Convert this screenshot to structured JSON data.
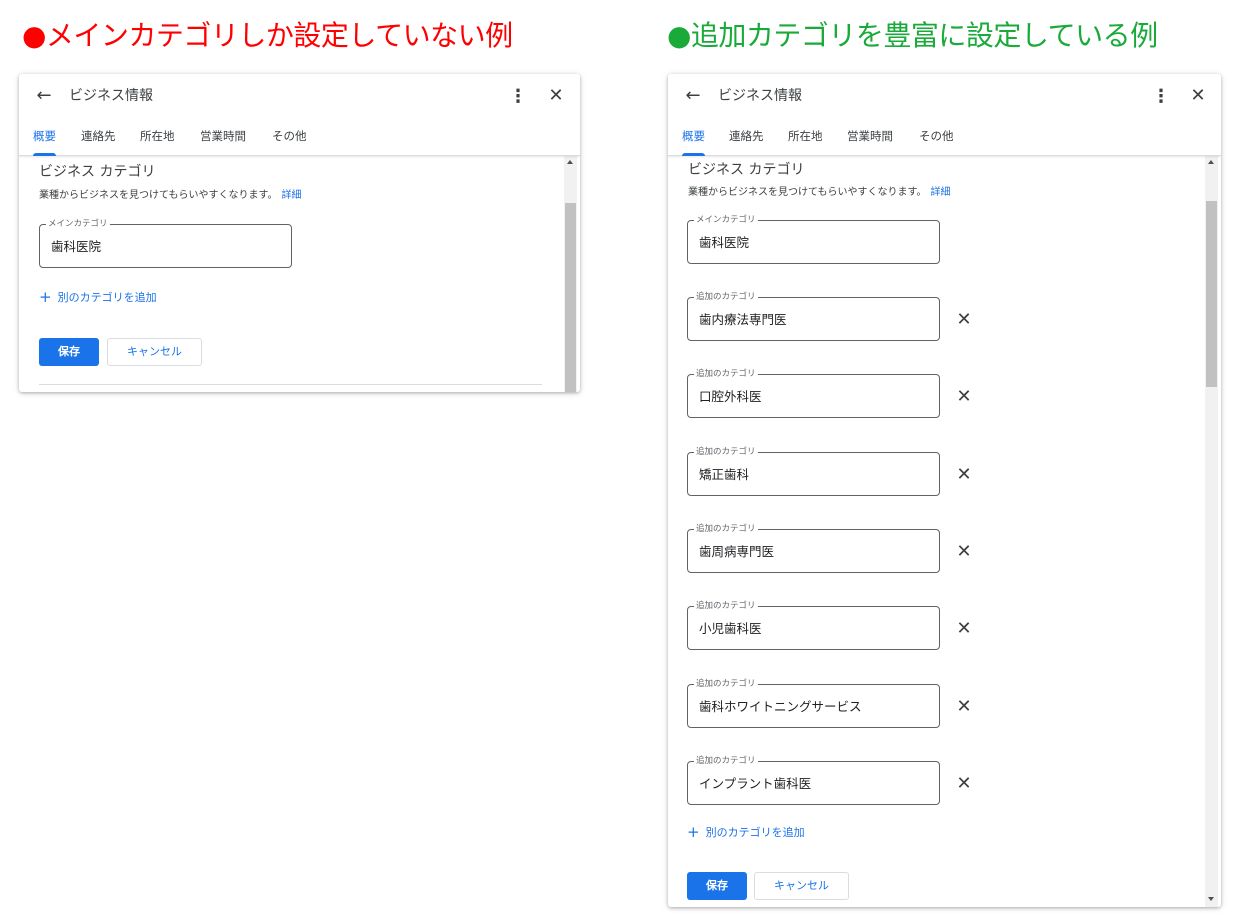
{
  "headings": {
    "left": "●メインカテゴリしか設定していない例",
    "right": "●追加カテゴリを豊富に設定している例"
  },
  "colors": {
    "left_heading": "#ff0000",
    "right_heading": "#1aaa3a",
    "accent": "#1a73e8"
  },
  "dialog": {
    "back_icon": "arrow-left-icon",
    "title": "ビジネス情報",
    "more_icon": "more-vert-icon",
    "close_icon": "close-icon",
    "tabs": [
      "概要",
      "連絡先",
      "所在地",
      "営業時間",
      "その他"
    ],
    "active_tab": "概要",
    "section_title": "ビジネス カテゴリ",
    "section_desc": "業種からビジネスを見つけてもらいやすくなります。",
    "details_link": "詳細",
    "main_category_label": "メインカテゴリ",
    "additional_category_label": "追加のカテゴリ",
    "add_category": "別のカテゴリを追加",
    "save": "保存",
    "cancel": "キャンセル"
  },
  "left_panel": {
    "main_category": "歯科医院"
  },
  "right_panel": {
    "main_category": "歯科医院",
    "additional_categories": [
      "歯内療法専門医",
      "口腔外科医",
      "矯正歯科",
      "歯周病専門医",
      "小児歯科医",
      "歯科ホワイトニングサービス",
      "インプラント歯科医"
    ]
  }
}
